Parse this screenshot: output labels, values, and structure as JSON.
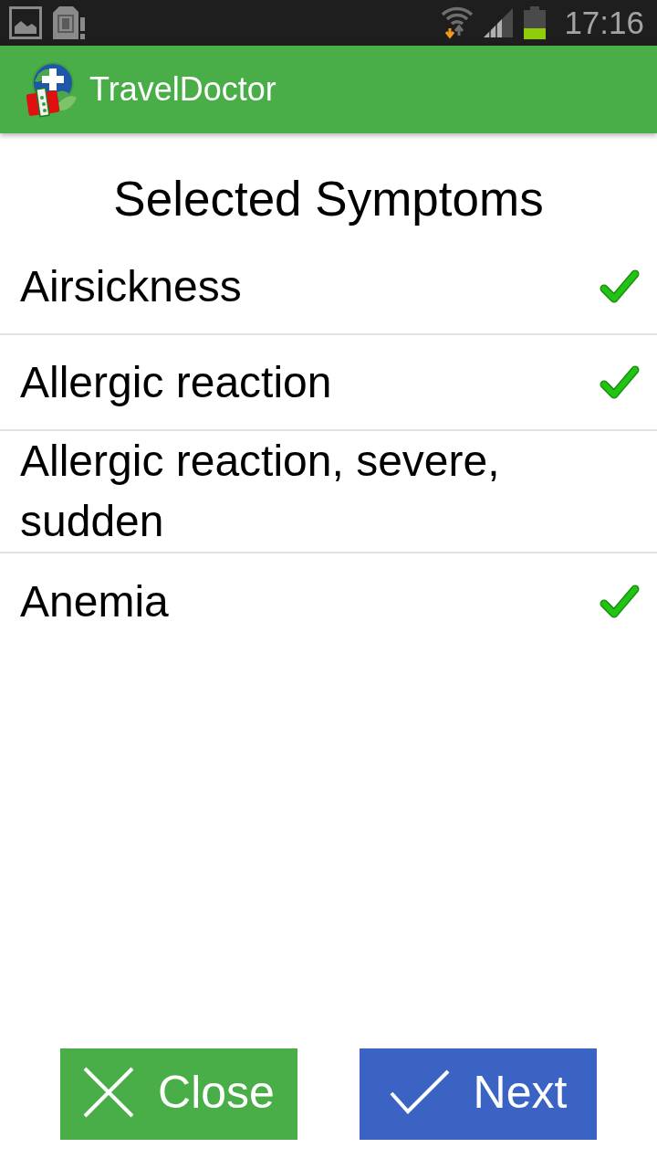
{
  "status_bar": {
    "time": "17:16"
  },
  "app_bar": {
    "title": "TravelDoctor"
  },
  "heading": "Selected Symptoms",
  "symptoms": [
    {
      "name": "Airsickness",
      "checked": true
    },
    {
      "name": "Allergic reaction",
      "checked": true
    },
    {
      "name": "Allergic reaction, severe, sudden",
      "checked": false
    },
    {
      "name": "Anemia",
      "checked": true
    }
  ],
  "buttons": [
    {
      "kind": "close",
      "label": "Close"
    },
    {
      "kind": "next",
      "label": "Next"
    }
  ]
}
